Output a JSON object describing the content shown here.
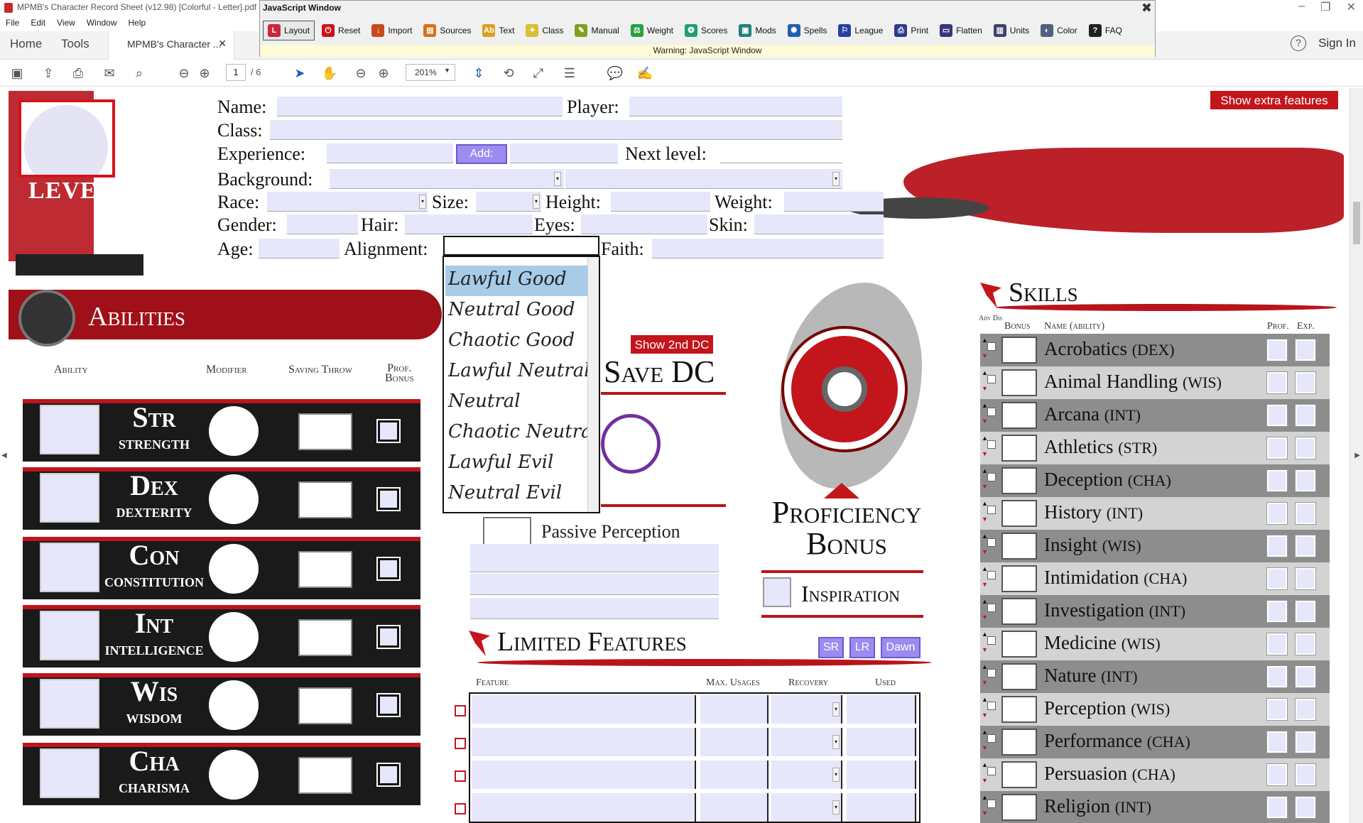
{
  "window": {
    "title": "MPMB's Character Record Sheet (v12.98) [Colorful - Letter].pdf - Adobe Acrobat Reader DC",
    "controls": [
      "–",
      "❐",
      "✕"
    ]
  },
  "menu": [
    "File",
    "Edit",
    "View",
    "Window",
    "Help"
  ],
  "nav": {
    "home": "Home",
    "tools": "Tools",
    "doc_tab": "MPMB's Character ...",
    "doc_close": "✕",
    "help": "?",
    "signin": "Sign In"
  },
  "toolbar": {
    "page_current": "1",
    "page_total": "/ 6",
    "zoom": "201%"
  },
  "js_window": {
    "title": "JavaScript Window",
    "close": "✖",
    "buttons": [
      {
        "label": "Layout",
        "color": "#c8283c",
        "glyph": "L"
      },
      {
        "label": "Reset",
        "color": "#c8141c",
        "glyph": "⏻"
      },
      {
        "label": "Import",
        "color": "#c84a1c",
        "glyph": "↓"
      },
      {
        "label": "Sources",
        "color": "#d87018",
        "glyph": "▤"
      },
      {
        "label": "Text",
        "color": "#d8a020",
        "glyph": "Ab"
      },
      {
        "label": "Class",
        "color": "#d8c030",
        "glyph": "✦"
      },
      {
        "label": "Manual",
        "color": "#80a020",
        "glyph": "✎"
      },
      {
        "label": "Weight",
        "color": "#28a040",
        "glyph": "⚖"
      },
      {
        "label": "Scores",
        "color": "#20a070",
        "glyph": "❂"
      },
      {
        "label": "Mods",
        "color": "#208080",
        "glyph": "▣"
      },
      {
        "label": "Spells",
        "color": "#2060b0",
        "glyph": "✺"
      },
      {
        "label": "League",
        "color": "#2840a0",
        "glyph": "⚐"
      },
      {
        "label": "Print",
        "color": "#303890",
        "glyph": "⎙"
      },
      {
        "label": "Flatten",
        "color": "#383878",
        "glyph": "▭"
      },
      {
        "label": "Units",
        "color": "#404070",
        "glyph": "▥"
      },
      {
        "label": "Color",
        "color": "#506080",
        "glyph": "◐"
      },
      {
        "label": "FAQ",
        "color": "#202020",
        "glyph": "?"
      }
    ],
    "warning": "Warning: JavaScript Window"
  },
  "header_fields": {
    "name": "Name:",
    "player": "Player:",
    "class": "Class:",
    "experience": "Experience:",
    "add": "Add:",
    "next_level": "Next level:",
    "background": "Background:",
    "race": "Race:",
    "size": "Size:",
    "height": "Height:",
    "weight": "Weight:",
    "gender": "Gender:",
    "hair": "Hair:",
    "eyes": "Eyes:",
    "skin": "Skin:",
    "age": "Age:",
    "alignment": "Alignment:",
    "faith": "Faith:"
  },
  "level_label": "LEVEL",
  "show_extra": "Show extra features",
  "abilities": {
    "title": "Abilities",
    "headers": {
      "ability": "Ability",
      "modifier": "Modifier",
      "saving_throw": "Saving Throw",
      "prof": "Prof.",
      "bonus": "Bonus"
    },
    "rows": [
      {
        "short": "Str",
        "full": "STRENGTH"
      },
      {
        "short": "Dex",
        "full": "DEXTERITY"
      },
      {
        "short": "Con",
        "full": "CONSTITUTION"
      },
      {
        "short": "Int",
        "full": "INTELLIGENCE"
      },
      {
        "short": "Wis",
        "full": "WISDOM"
      },
      {
        "short": "Cha",
        "full": "CHARISMA"
      }
    ]
  },
  "alignment_options": [
    "Lawful Good",
    "Neutral Good",
    "Chaotic Good",
    "Lawful Neutral",
    "Neutral",
    "Chaotic Neutral",
    "Lawful Evil",
    "Neutral Evil"
  ],
  "alignment_selected": "Lawful Good",
  "save_dc": {
    "show_2nd": "Show 2nd DC",
    "title": "Save DC"
  },
  "passive_perception": "Passive Perception",
  "proficiency_bonus": "Proficiency Bonus",
  "inspiration": "Inspiration",
  "limited_features": {
    "title": "Limited Features",
    "rest_buttons": [
      "SR",
      "LR",
      "Dawn"
    ],
    "headers": {
      "feature": "Feature",
      "max": "Max. Usages",
      "recovery": "Recovery",
      "used": "Used"
    }
  },
  "skills": {
    "title": "Skills",
    "headers": {
      "adv": "Adv Dis",
      "bonus": "Bonus",
      "name": "Name (ability)",
      "prof": "Prof.",
      "exp": "Exp."
    },
    "rows": [
      {
        "name": "Acrobatics",
        "ability": "(DEX)"
      },
      {
        "name": "Animal Handling",
        "ability": "(WIS)"
      },
      {
        "name": "Arcana",
        "ability": "(INT)"
      },
      {
        "name": "Athletics",
        "ability": "(STR)"
      },
      {
        "name": "Deception",
        "ability": "(CHA)"
      },
      {
        "name": "History",
        "ability": "(INT)"
      },
      {
        "name": "Insight",
        "ability": "(WIS)"
      },
      {
        "name": "Intimidation",
        "ability": "(CHA)"
      },
      {
        "name": "Investigation",
        "ability": "(INT)"
      },
      {
        "name": "Medicine",
        "ability": "(WIS)"
      },
      {
        "name": "Nature",
        "ability": "(INT)"
      },
      {
        "name": "Perception",
        "ability": "(WIS)"
      },
      {
        "name": "Performance",
        "ability": "(CHA)"
      },
      {
        "name": "Persuasion",
        "ability": "(CHA)"
      },
      {
        "name": "Religion",
        "ability": "(INT)"
      }
    ]
  },
  "colors": {
    "accent_red": "#c3151c",
    "field_fill": "#e6e7fb",
    "button_purple": "#9c8cf0",
    "selected_option": "#a8cbe8"
  }
}
